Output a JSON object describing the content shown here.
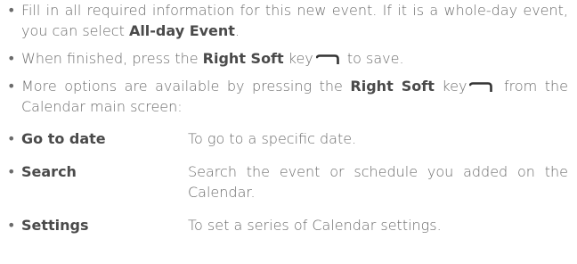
{
  "bullets": [
    {
      "text_before": "Fill in all required information for this new event. If it is a whole-day event, you can select ",
      "bold": "All-day Event",
      "text_after": "."
    },
    {
      "text_before": "When finished, press the ",
      "bold": "Right Soft",
      "text_mid": " key",
      "text_after": " to save.",
      "icon": "right-soft-key-icon"
    },
    {
      "text_before": "More options are available by pressing the ",
      "bold": "Right Soft",
      "text_mid": " key",
      "text_after": " from the Calendar main screen:",
      "icon": "right-soft-key-icon"
    }
  ],
  "options": [
    {
      "label": "Go to date",
      "description": "To go to a specific date."
    },
    {
      "label": "Search",
      "description": "Search the event or schedule you added on the Calendar."
    },
    {
      "label": "Settings",
      "description": "To set a series of Calendar settings."
    }
  ],
  "bullet_symbol": "•",
  "colors": {
    "body_text": "#6b6b6b",
    "bold_text": "#4a4a4a",
    "icon": "#333333"
  }
}
